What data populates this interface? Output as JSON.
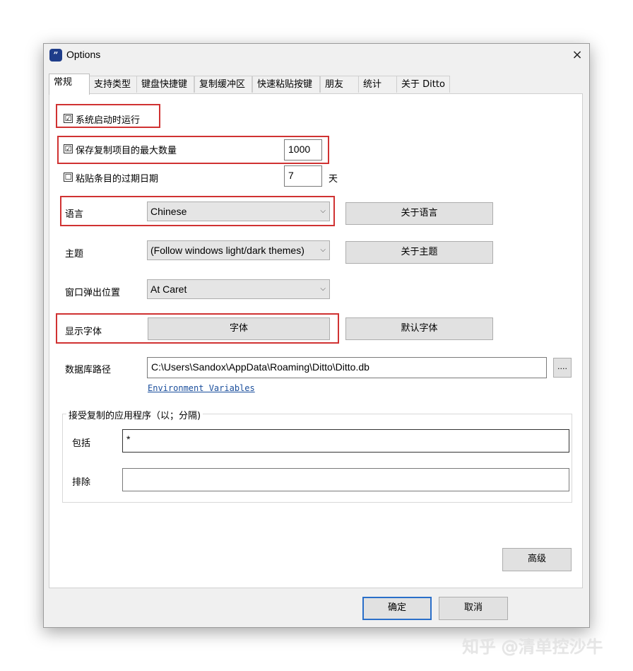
{
  "window": {
    "title": "Options",
    "close": "×",
    "icon_glyph": "”"
  },
  "tabs": [
    {
      "label": "常规"
    },
    {
      "label": "支持类型"
    },
    {
      "label": "键盘快捷键"
    },
    {
      "label": "复制缓冲区"
    },
    {
      "label": "快速粘贴按键"
    },
    {
      "label": "朋友"
    },
    {
      "label": "统计"
    },
    {
      "label": "关于 Ditto"
    }
  ],
  "general": {
    "run_on_startup": {
      "label": "系统启动时运行",
      "checked": "☑"
    },
    "max_saved": {
      "label": "保存复制项目的最大数量",
      "checked": "☑",
      "value": "1000"
    },
    "expire": {
      "label": "粘贴条目的过期日期",
      "checked": "☐",
      "value": "7",
      "unit": "天"
    },
    "language": {
      "label": "语言",
      "value": "Chinese",
      "about_button": "关于语言"
    },
    "theme": {
      "label": "主题",
      "value": "(Follow windows light/dark themes)",
      "about_button": "关于主题"
    },
    "popup_position": {
      "label": "窗口弹出位置",
      "value": "At Caret"
    },
    "font": {
      "label": "显示字体",
      "button": "字体",
      "default_button": "默认字体"
    },
    "db_path": {
      "label": "数据库路径",
      "value": "C:\\Users\\Sandox\\AppData\\Roaming\\Ditto\\Ditto.db",
      "browse": "...."
    },
    "env_link": "Environment Variables",
    "apps_group": {
      "title": "接受复制的应用程序（以；分隔)",
      "include_label": "包括",
      "include_value": "*",
      "exclude_label": "排除",
      "exclude_value": ""
    },
    "advanced_button": "高级"
  },
  "footer": {
    "ok": "确定",
    "cancel": "取消"
  },
  "watermark": "知乎 @清单控沙牛",
  "dropdown_arrow": "⌵"
}
